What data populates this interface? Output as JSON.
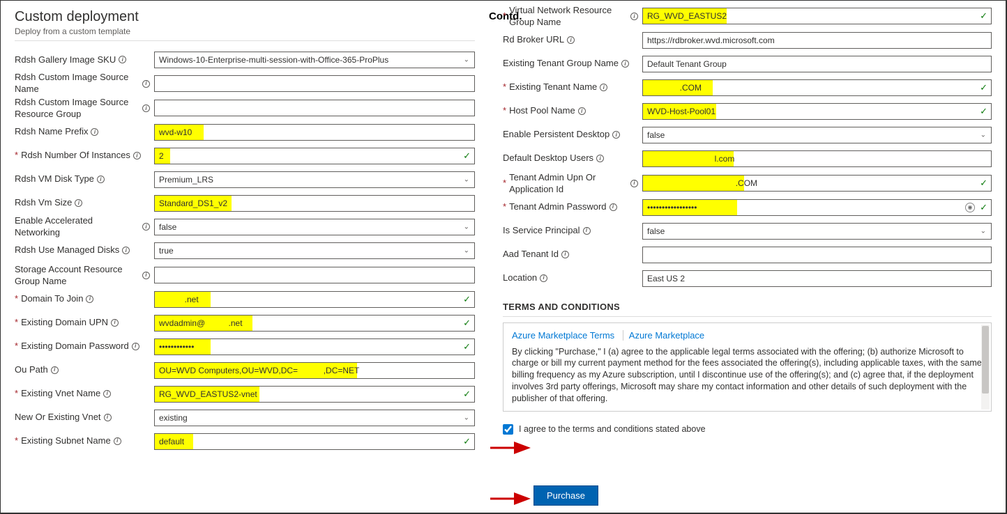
{
  "header": {
    "title": "Custom deployment",
    "subtitle": "Deploy from a custom template",
    "contd": "Contd."
  },
  "left": {
    "gallery_sku": {
      "label": "Rdsh Gallery Image SKU",
      "value": "Windows-10-Enterprise-multi-session-with-Office-365-ProPlus"
    },
    "custom_img_name": {
      "label": "Rdsh Custom Image Source Name",
      "value": ""
    },
    "custom_img_rg": {
      "label": "Rdsh Custom Image Source Resource Group",
      "value": ""
    },
    "name_prefix": {
      "label": "Rdsh Name Prefix",
      "value": "wvd-w10"
    },
    "num_instances": {
      "label": "Rdsh Number Of Instances",
      "value": "2"
    },
    "disk_type": {
      "label": "Rdsh VM Disk Type",
      "value": "Premium_LRS"
    },
    "vm_size": {
      "label": "Rdsh Vm Size",
      "value": "Standard_DS1_v2"
    },
    "accel_net": {
      "label": "Enable Accelerated Networking",
      "value": "false"
    },
    "managed_disks": {
      "label": "Rdsh Use Managed Disks",
      "value": "true"
    },
    "storage_rg": {
      "label": "Storage Account Resource Group Name",
      "value": ""
    },
    "domain_join": {
      "label": "Domain To Join",
      "value": "           .net"
    },
    "domain_upn": {
      "label": "Existing Domain UPN",
      "value": "wvdadmin@          .net"
    },
    "domain_pwd": {
      "label": "Existing Domain Password",
      "value": "••••••••••••"
    },
    "ou_path": {
      "label": "Ou Path",
      "value": "OU=WVD Computers,OU=WVD,DC=           ,DC=NET"
    },
    "vnet_name": {
      "label": "Existing Vnet Name",
      "value": "RG_WVD_EASTUS2-vnet"
    },
    "new_exist_vnet": {
      "label": "New Or Existing Vnet",
      "value": "existing"
    },
    "subnet_name": {
      "label": "Existing Subnet Name",
      "value": "default"
    }
  },
  "right": {
    "vnet_rg": {
      "label": "Virtual Network Resource Group Name",
      "value": "RG_WVD_EASTUS2"
    },
    "broker_url": {
      "label": "Rd Broker URL",
      "value": "https://rdbroker.wvd.microsoft.com"
    },
    "tenant_group": {
      "label": "Existing Tenant Group Name",
      "value": "Default Tenant Group"
    },
    "tenant_name": {
      "label": "Existing Tenant Name",
      "value": "              .COM"
    },
    "host_pool": {
      "label": "Host Pool Name",
      "value": "WVD-Host-Pool01"
    },
    "persistent": {
      "label": "Enable Persistent Desktop",
      "value": "false"
    },
    "default_users": {
      "label": "Default Desktop Users",
      "value": "                             l.com"
    },
    "admin_upn": {
      "label": "Tenant Admin Upn Or Application Id",
      "value": "                                      .COM"
    },
    "admin_pwd": {
      "label": "Tenant Admin Password",
      "value": "•••••••••••••••••"
    },
    "is_sp": {
      "label": "Is Service Principal",
      "value": "false"
    },
    "aad_tenant": {
      "label": "Aad Tenant Id",
      "value": ""
    },
    "location": {
      "label": "Location",
      "value": "East US 2"
    }
  },
  "terms": {
    "heading": "TERMS AND CONDITIONS",
    "link1": "Azure Marketplace Terms",
    "link2": "Azure Marketplace",
    "body": "By clicking \"Purchase,\" I (a) agree to the applicable legal terms associated with the offering; (b) authorize Microsoft to charge or bill my current payment method for the fees associated the offering(s), including applicable taxes, with the same billing frequency as my Azure subscription, until I discontinue use of the offering(s); and (c) agree that, if the deployment involves 3rd party offerings, Microsoft may share my contact information and other details of such deployment with the publisher of that offering.",
    "agree": "I agree to the terms and conditions stated above"
  },
  "purchase": "Purchase"
}
